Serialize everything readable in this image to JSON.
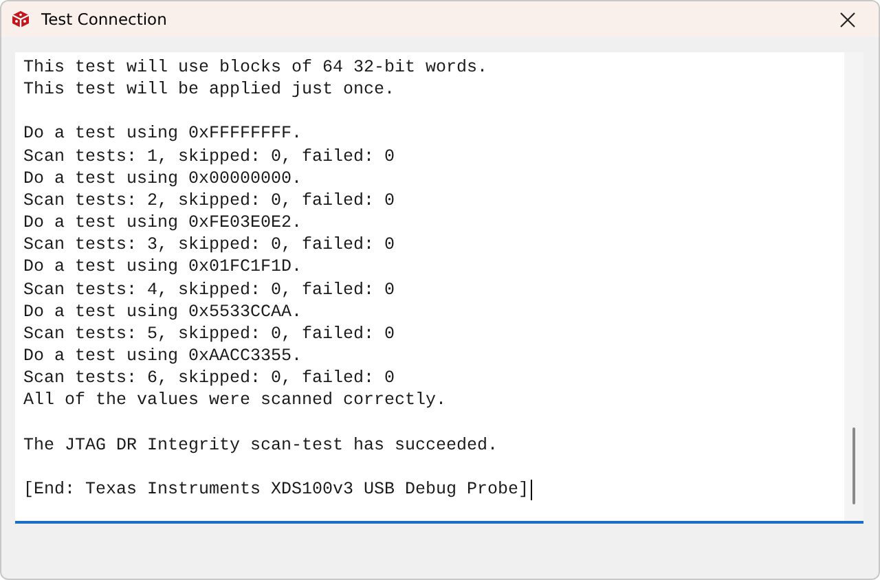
{
  "window": {
    "title": "Test Connection"
  },
  "output": {
    "blocks": [
      [
        "This test will use blocks of 64 32-bit words.",
        "This test will be applied just once."
      ],
      [
        "Do a test using 0xFFFFFFFF.",
        "Scan tests: 1, skipped: 0, failed: 0",
        "Do a test using 0x00000000.",
        "Scan tests: 2, skipped: 0, failed: 0",
        "Do a test using 0xFE03E0E2.",
        "Scan tests: 3, skipped: 0, failed: 0",
        "Do a test using 0x01FC1F1D.",
        "Scan tests: 4, skipped: 0, failed: 0",
        "Do a test using 0x5533CCAA.",
        "Scan tests: 5, skipped: 0, failed: 0",
        "Do a test using 0xAACC3355.",
        "Scan tests: 6, skipped: 0, failed: 0",
        "All of the values were scanned correctly."
      ],
      [
        "The JTAG DR Integrity scan-test has succeeded."
      ],
      [
        "[End: Texas Instruments XDS100v3 USB Debug Probe]"
      ]
    ]
  }
}
